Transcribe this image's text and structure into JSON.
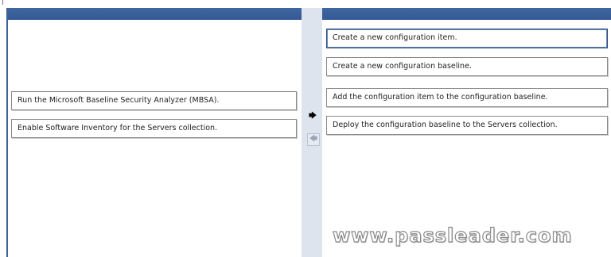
{
  "left_list": {
    "items": [
      "Run the Microsoft Baseline Security Analyzer (MBSA).",
      "Enable Software Inventory for the Servers collection."
    ]
  },
  "right_list": {
    "items": [
      "Create a new configuration item.",
      "Create a new configuration baseline.",
      "Add the configuration item to the configuration baseline.",
      "Deploy the configuration baseline to the Servers collection."
    ]
  },
  "buttons": {
    "move_right_glyph": "🡆",
    "move_left_glyph": "🡄",
    "move_right_icon": "arrow-right-icon",
    "move_left_icon": "arrow-left-icon"
  },
  "watermark": "www.passleader.com",
  "colors": {
    "header": "#3f669f",
    "splitter": "#dde4ee"
  }
}
